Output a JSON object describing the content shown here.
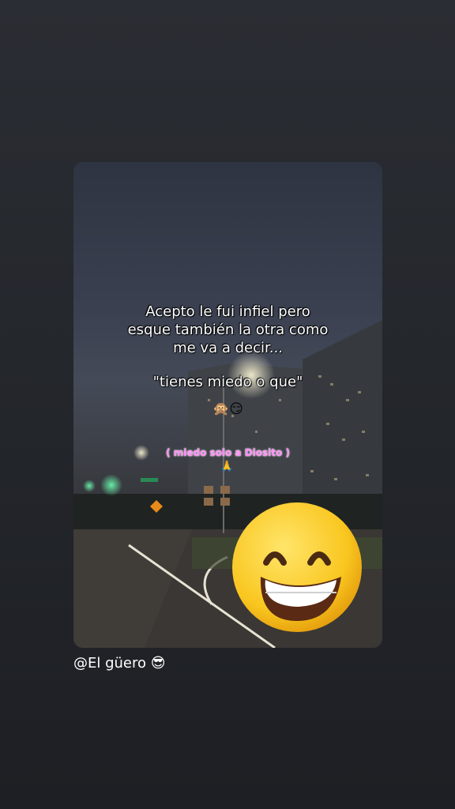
{
  "story": {
    "caption_lines": [
      "Acepto le fui infiel pero",
      "esque también la otra como",
      "me va a decir...",
      "\"tienes miedo o que\""
    ],
    "emoji_row": "🙊😏",
    "pink_note": "( miedo solo a Diosito )",
    "pray_emoji": "🙏"
  },
  "footer": {
    "user_tag": "@El güero 😎"
  },
  "icons": {
    "big_emoji": "grinning-face-with-smiling-eyes-icon"
  },
  "colors": {
    "background": "#24272c",
    "caption_text": "#ffffff",
    "pink_note": "#ff8cf5",
    "emoji_yellow": "#f9c61f"
  }
}
